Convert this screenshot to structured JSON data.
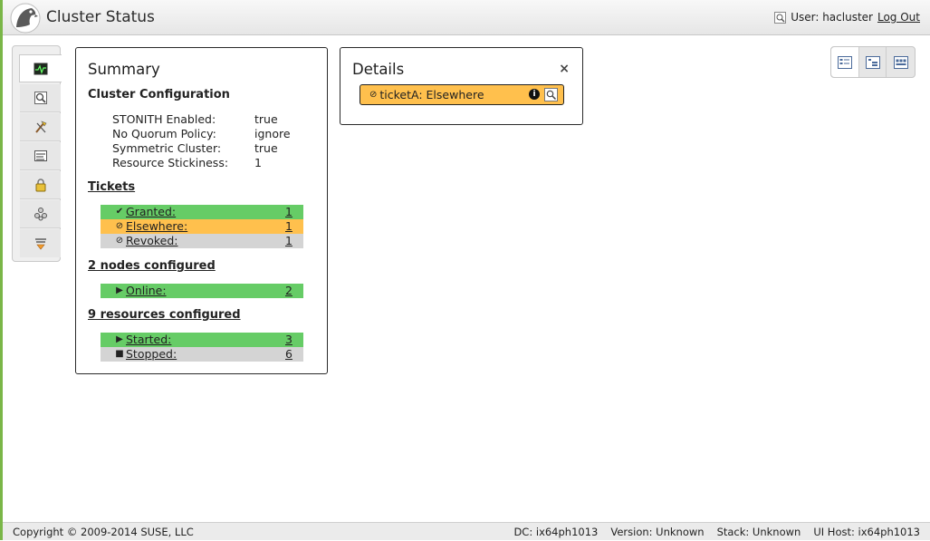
{
  "header": {
    "title": "Cluster Status",
    "user_label": "User: hacluster",
    "logout_label": "Log Out"
  },
  "sidebar": {
    "items": [
      {
        "icon": "dashboard-icon",
        "active": true
      },
      {
        "icon": "history-explorer-icon"
      },
      {
        "icon": "tools-icon"
      },
      {
        "icon": "cluster-properties-icon"
      },
      {
        "icon": "access-control-icon"
      },
      {
        "icon": "resources-icon"
      },
      {
        "icon": "filter-icon"
      }
    ]
  },
  "summary": {
    "title": "Summary",
    "config_title": "Cluster Configuration",
    "config": [
      {
        "key": "STONITH Enabled:",
        "value": "true"
      },
      {
        "key": "No Quorum Policy:",
        "value": "ignore"
      },
      {
        "key": "Symmetric Cluster:",
        "value": "true"
      },
      {
        "key": "Resource Stickiness:",
        "value": "1"
      }
    ],
    "tickets_title": "Tickets",
    "tickets": [
      {
        "symbol": "✔",
        "label": "Granted:",
        "count": "1",
        "color": "#66cc66"
      },
      {
        "symbol": "⊘",
        "label": "Elsewhere:",
        "count": "1",
        "color": "#ffc04d"
      },
      {
        "symbol": "⊘",
        "label": "Revoked:",
        "count": "1",
        "color": "#d4d4d4"
      }
    ],
    "nodes_title": "2 nodes configured",
    "nodes": [
      {
        "symbol": "▶",
        "label": "Online:",
        "count": "2",
        "color": "#66cc66"
      }
    ],
    "resources_title": "9 resources configured",
    "resources": [
      {
        "symbol": "▶",
        "label": "Started:",
        "count": "3",
        "color": "#66cc66"
      },
      {
        "symbol": "■",
        "label": "Stopped:",
        "count": "6",
        "color": "#d4d4d4"
      }
    ]
  },
  "details": {
    "title": "Details",
    "close": "×",
    "ticket": {
      "symbol": "⊘",
      "label": "ticketA: Elsewhere",
      "info": "i"
    }
  },
  "footer": {
    "copyright": "Copyright © 2009-2014 SUSE, LLC",
    "dc": "DC: ix64ph1013",
    "version": "Version: Unknown",
    "stack": "Stack: Unknown",
    "ui_host": "UI Host: ix64ph1013"
  },
  "colors": {
    "accent_green": "#7ab648",
    "ok": "#66cc66",
    "warning": "#ffc04d",
    "neutral": "#d4d4d4"
  }
}
